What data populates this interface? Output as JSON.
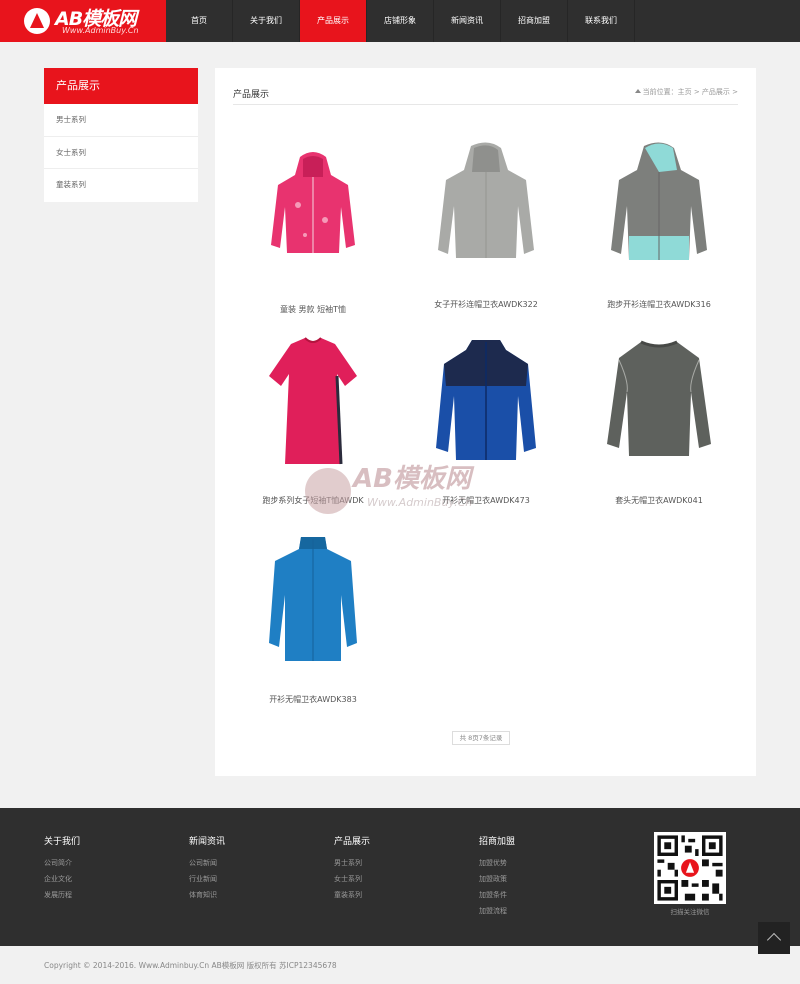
{
  "brand": {
    "name": "AB模板网",
    "url": "Www.AdminBuy.Cn",
    "accent": "#e8141c",
    "dark": "#2f2f2f"
  },
  "nav": [
    "首页",
    "关于我们",
    "产品展示",
    "店铺形象",
    "新闻资讯",
    "招商加盟",
    "联系我们"
  ],
  "nav_active_index": 2,
  "sidebar": {
    "title": "产品展示",
    "items": [
      "男士系列",
      "女士系列",
      "童装系列"
    ]
  },
  "main": {
    "title": "产品展示",
    "breadcrumb": "当前位置：主页 > 产品展示 >"
  },
  "products": [
    {
      "name": "童装 男款 短袖T恤",
      "icon": "pink-hoodie-image"
    },
    {
      "name": "女子开衫连帽卫衣AWDK322",
      "icon": "grey-hoodie-image"
    },
    {
      "name": "跑步开衫连帽卫衣AWDK316",
      "icon": "grey-mint-hoodie-image"
    },
    {
      "name": "跑步系列女子短袖T恤AWDK",
      "icon": "pink-tshirt-image"
    },
    {
      "name": "开衫无帽卫衣AWDK473",
      "icon": "blue-jacket-image"
    },
    {
      "name": "套头无帽卫衣AWDK041",
      "icon": "grey-sweater-image"
    },
    {
      "name": "开衫无帽卫衣AWDK383",
      "icon": "blue-zip-jacket-image"
    }
  ],
  "pager": "共 8页7条记录",
  "watermark": {
    "title": "AB模板网",
    "sub": "Www.AdminBuy.Cn"
  },
  "footer": {
    "columns": [
      {
        "title": "关于我们",
        "links": [
          "公司简介",
          "企业文化",
          "发展历程"
        ]
      },
      {
        "title": "新闻资讯",
        "links": [
          "公司新闻",
          "行业新闻",
          "体育知识"
        ]
      },
      {
        "title": "产品展示",
        "links": [
          "男士系列",
          "女士系列",
          "童装系列"
        ]
      },
      {
        "title": "招商加盟",
        "links": [
          "加盟优势",
          "加盟政策",
          "加盟条件",
          "加盟流程"
        ]
      }
    ],
    "qr_label": "扫描关注微信",
    "copyright": "Copyright © 2014-2016. Www.Adminbuy.Cn AB模板网 版权所有   苏ICP12345678"
  }
}
